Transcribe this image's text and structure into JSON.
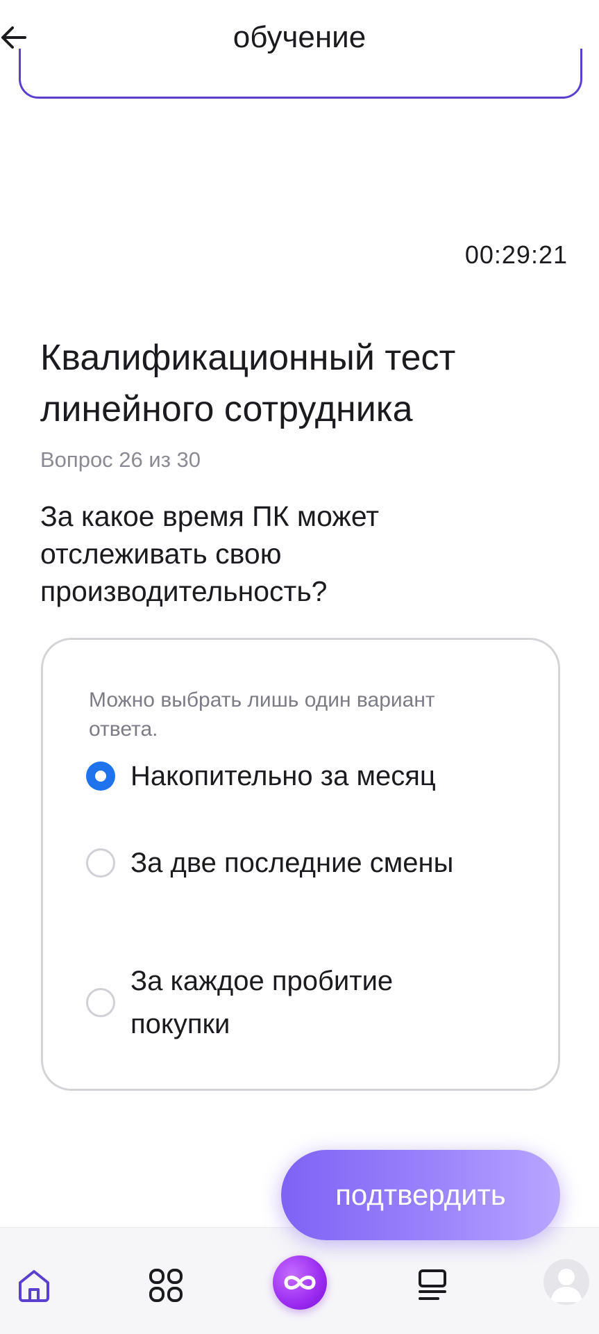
{
  "header": {
    "title": "обучение"
  },
  "timer": "00:29:21",
  "test": {
    "title": "Квалификационный тест линейного сотрудника",
    "counter": "Вопрос 26 из 30",
    "question": "За какое время ПК может отслеживать свою производительность?"
  },
  "options_card": {
    "hint": "Можно выбрать лишь один вариант ответа.",
    "options": [
      {
        "label": "Накопительно за месяц",
        "selected": true
      },
      {
        "label": "За две последние смены",
        "selected": false
      },
      {
        "label": "За каждое пробитие покупки",
        "selected": false
      }
    ]
  },
  "confirm_label": "подтвердить",
  "colors": {
    "accent": "#1f74ee",
    "brand_purple": "#5b3fd1",
    "button_gradient_start": "#7e63f4",
    "button_gradient_end": "#b8a6ff",
    "nav_active": "#5b3fd1"
  },
  "nav": {
    "items": [
      {
        "icon": "home-icon",
        "active": true
      },
      {
        "icon": "grid-icon",
        "active": false
      },
      {
        "icon": "infinity-logo-icon",
        "active": false
      },
      {
        "icon": "list-icon",
        "active": false
      },
      {
        "icon": "profile-avatar-icon",
        "active": false
      }
    ]
  }
}
